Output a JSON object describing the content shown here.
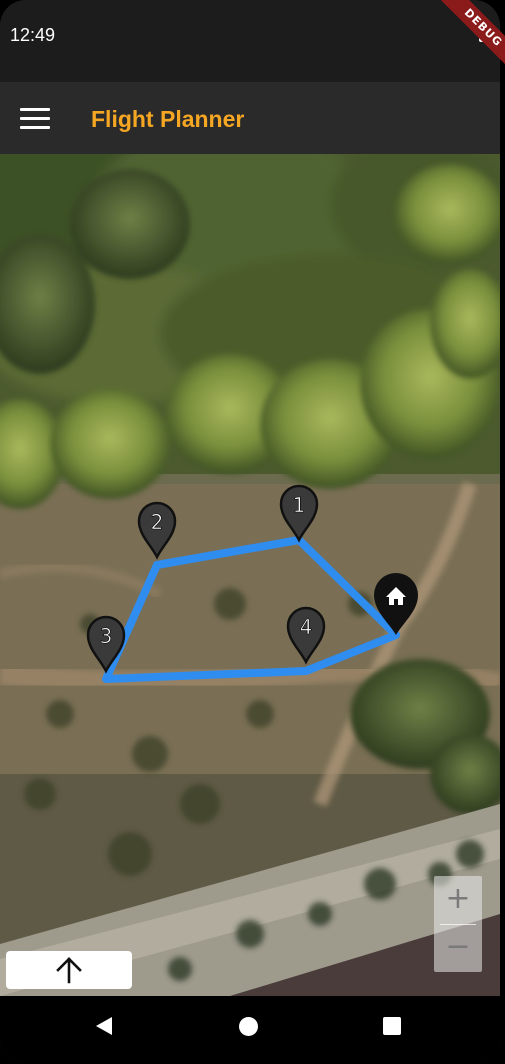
{
  "status_bar": {
    "time": "12:49",
    "debug_label": "DEBUG"
  },
  "app_bar": {
    "title": "Flight Planner",
    "title_color": "#f5a623",
    "menu_icon": "hamburger-menu-icon"
  },
  "map": {
    "route_color": "#2f8df0",
    "waypoints": [
      {
        "label": "1"
      },
      {
        "label": "2"
      },
      {
        "label": "3"
      },
      {
        "label": "4"
      }
    ],
    "home_marker": "home-icon",
    "zoom_in_label": "+",
    "zoom_out_label": "−",
    "compass_icon": "arrow-up-icon"
  },
  "nav_bar": {
    "back_icon": "back-triangle-icon",
    "home_icon": "home-circle-icon",
    "recents_icon": "recents-square-icon"
  }
}
